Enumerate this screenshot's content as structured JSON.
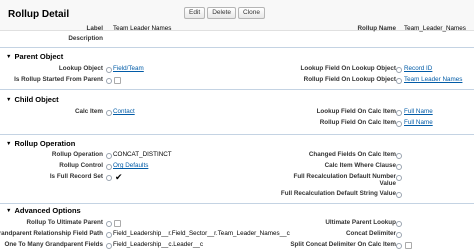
{
  "header": {
    "title": "Rollup Detail",
    "buttons": {
      "edit": "Edit",
      "delete": "Delete",
      "clone": "Clone"
    }
  },
  "top": {
    "label": {
      "label": "Label",
      "value": "Team Leader Names"
    },
    "rollup_name": {
      "label": "Rollup Name",
      "value": "Team_Leader_Names"
    },
    "description": {
      "label": "Description",
      "value": ""
    }
  },
  "parent_object": {
    "title": "Parent Object",
    "lookup_object": {
      "label": "Lookup Object",
      "value": "Field/Team"
    },
    "lookup_field_on_lookup_object": {
      "label": "Lookup Field On Lookup Object",
      "value": "Record ID"
    },
    "is_rollup_started_from_parent": {
      "label": "Is Rollup Started From Parent",
      "checked": false
    },
    "rollup_field_on_lookup_object": {
      "label": "Rollup Field On Lookup Object",
      "value": "Team Leader Names"
    }
  },
  "child_object": {
    "title": "Child Object",
    "calc_item": {
      "label": "Calc Item",
      "value": "Contact"
    },
    "lookup_field_on_calc_item": {
      "label": "Lookup Field On Calc Item",
      "value": "Full Name"
    },
    "rollup_field_on_calc_item": {
      "label": "Rollup Field On Calc Item",
      "value": "Full Name"
    }
  },
  "rollup_operation": {
    "title": "Rollup Operation",
    "rollup_operation": {
      "label": "Rollup Operation",
      "value": "CONCAT_DISTINCT"
    },
    "changed_fields": {
      "label": "Changed Fields On Calc Item",
      "value": ""
    },
    "rollup_control": {
      "label": "Rollup Control",
      "value": "Org Defaults"
    },
    "calc_item_where_clause": {
      "label": "Calc Item Where Clause",
      "value": ""
    },
    "is_full_record_set": {
      "label": "Is Full Record Set",
      "checked": true,
      "glyph": "✔"
    },
    "full_recalc_default_number": {
      "label_line1": "Full Recalculation Default Number",
      "label_line2": "Value",
      "value": ""
    },
    "full_recalc_default_string": {
      "label": "Full Recalculation Default String Value",
      "value": ""
    }
  },
  "advanced_options": {
    "title": "Advanced Options",
    "rollup_to_ultimate_parent": {
      "label": "Rollup To Ultimate Parent",
      "checked": false
    },
    "ultimate_parent_lookup": {
      "label": "Ultimate Parent Lookup",
      "value": ""
    },
    "grandparent_relationship_field_path": {
      "label": "Grandparent Relationship Field Path",
      "value": "Field_Leadership__r.Field_Sector__r.Team_Leader_Names__c"
    },
    "concat_delimiter": {
      "label": "Concat Delimiter",
      "value": ""
    },
    "one_to_many_grandparent_fields": {
      "label": "One To Many Grandparent Fields",
      "value": "Field_Leadership__c.Leader__c"
    },
    "split_concat_delimiter": {
      "label": "Split Concat Delimiter On Calc Item",
      "checked": false
    }
  },
  "colors": {
    "link": "#015ba7",
    "divider": "#c4d3e3",
    "header_bg": "#f8f8f8"
  },
  "icons": {
    "info": "info-icon",
    "collapse": "triangle-down-icon",
    "check": "checkmark-icon"
  }
}
